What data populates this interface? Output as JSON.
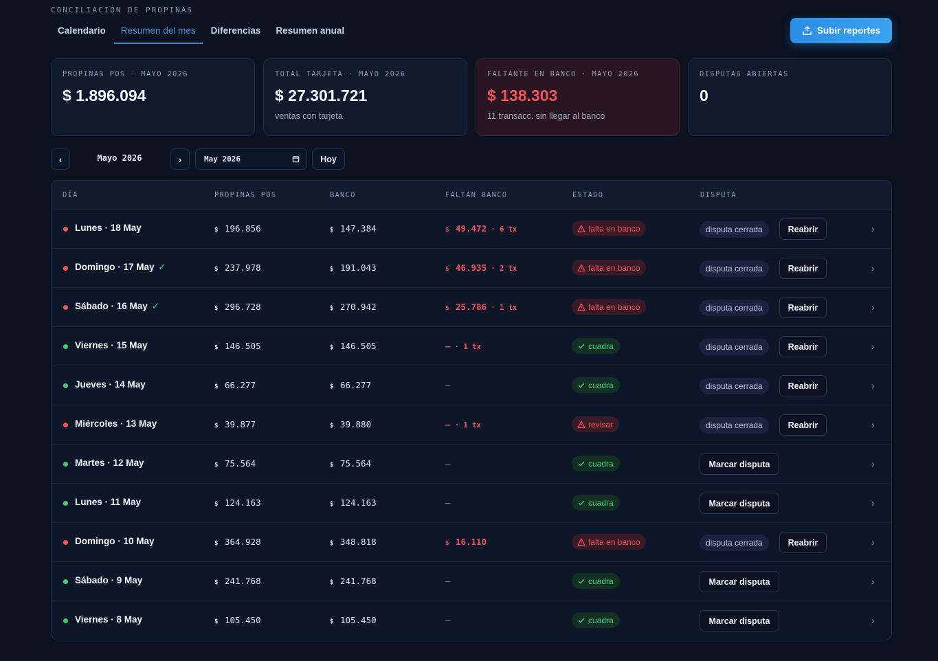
{
  "app_title": "CONCILIACIÓN DE PROPINAS",
  "tabs": [
    "Calendario",
    "Resumen del mes",
    "Diferencias",
    "Resumen anual"
  ],
  "active_tab": 1,
  "upload_button": "Subir reportes",
  "cards": [
    {
      "label": "PROPINAS POS · MAYO 2026",
      "value": "$ 1.896.094",
      "sub": ""
    },
    {
      "label": "TOTAL TARJETA · MAYO 2026",
      "value": "$ 27.301.721",
      "sub": "ventas con tarjeta"
    },
    {
      "label": "FALTANTE EN BANCO · MAYO 2026",
      "value": "$ 138.303",
      "sub": "11 transacc. sin llegar al banco"
    },
    {
      "label": "DISPUTAS ABIERTAS",
      "value": "0",
      "sub": ""
    }
  ],
  "month_nav": {
    "prev_icon": "‹",
    "next_icon": "›",
    "month_label": "Mayo 2026",
    "month_input_value": "May 2026",
    "today_button": "Hoy"
  },
  "table": {
    "headers": [
      "DÍA",
      "PROPINAS POS",
      "BANCO",
      "FALTAN BANCO",
      "ESTADO",
      "DISPUTA"
    ],
    "currency": "$",
    "rows": [
      {
        "status_color": "red",
        "day": "Lunes · 18 May",
        "check": "",
        "pos": "196.856",
        "bank": "147.384",
        "missing": "49.472",
        "missing_tx": "6 tx",
        "estado": "falta en banco",
        "estado_type": "bad",
        "closed_tag": "disputa cerrada",
        "action": "Reabrir"
      },
      {
        "status_color": "red",
        "day": "Domingo · 17 May",
        "check": "✓",
        "pos": "237.978",
        "bank": "191.043",
        "missing": "46.935",
        "missing_tx": "2 tx",
        "estado": "falta en banco",
        "estado_type": "bad",
        "closed_tag": "disputa cerrada",
        "action": "Reabrir"
      },
      {
        "status_color": "red",
        "day": "Sábado · 16 May",
        "check": "✓",
        "pos": "296.728",
        "bank": "270.942",
        "missing": "25.786",
        "missing_tx": "1 tx",
        "estado": "falta en banco",
        "estado_type": "bad",
        "closed_tag": "disputa cerrada",
        "action": "Reabrir"
      },
      {
        "status_color": "green",
        "day": "Viernes · 15 May",
        "check": "",
        "pos": "146.505",
        "bank": "146.505",
        "missing": "—",
        "missing_tx": "1 tx",
        "estado": "cuadra",
        "estado_type": "good",
        "closed_tag": "disputa cerrada",
        "action": "Reabrir"
      },
      {
        "status_color": "green",
        "day": "Jueves · 14 May",
        "check": "",
        "pos": "66.277",
        "bank": "66.277",
        "missing": "—",
        "missing_tx": "",
        "estado": "cuadra",
        "estado_type": "good",
        "closed_tag": "disputa cerrada",
        "action": "Reabrir"
      },
      {
        "status_color": "red",
        "day": "Miércoles · 13 May",
        "check": "",
        "pos": "39.877",
        "bank": "39.880",
        "missing": "—",
        "missing_tx": "1 tx",
        "estado": "revisar",
        "estado_type": "bad",
        "closed_tag": "disputa cerrada",
        "action": "Reabrir"
      },
      {
        "status_color": "green",
        "day": "Martes · 12 May",
        "check": "",
        "pos": "75.564",
        "bank": "75.564",
        "missing": "—",
        "missing_tx": "",
        "estado": "cuadra",
        "estado_type": "good",
        "closed_tag": "",
        "action": "Marcar disputa"
      },
      {
        "status_color": "green",
        "day": "Lunes · 11 May",
        "check": "",
        "pos": "124.163",
        "bank": "124.163",
        "missing": "—",
        "missing_tx": "",
        "estado": "cuadra",
        "estado_type": "good",
        "closed_tag": "",
        "action": "Marcar disputa"
      },
      {
        "status_color": "red",
        "day": "Domingo · 10 May",
        "check": "",
        "pos": "364.928",
        "bank": "348.818",
        "missing": "16.110",
        "missing_tx": "",
        "estado": "falta en banco",
        "estado_type": "bad",
        "closed_tag": "disputa cerrada",
        "action": "Reabrir"
      },
      {
        "status_color": "green",
        "day": "Sábado · 9 May",
        "check": "",
        "pos": "241.768",
        "bank": "241.768",
        "missing": "—",
        "missing_tx": "",
        "estado": "cuadra",
        "estado_type": "good",
        "closed_tag": "",
        "action": "Marcar disputa"
      },
      {
        "status_color": "green",
        "day": "Viernes · 8 May",
        "check": "",
        "pos": "105.450",
        "bank": "105.450",
        "missing": "—",
        "missing_tx": "",
        "estado": "cuadra",
        "estado_type": "good",
        "closed_tag": "",
        "action": "Marcar disputa"
      }
    ]
  },
  "colors": {
    "accent": "#3a86d6",
    "danger": "#f0555c",
    "success": "#3fce7a",
    "background": "#0b1220"
  }
}
